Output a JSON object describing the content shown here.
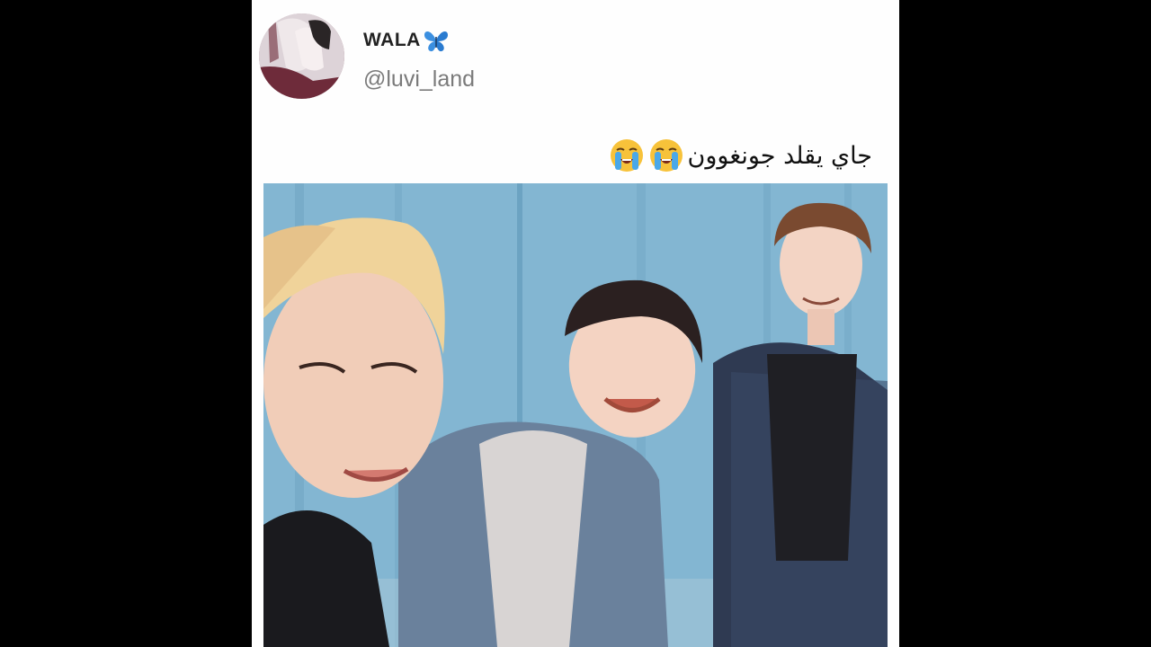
{
  "tweet": {
    "display_name": "WALA",
    "handle": "@luvi_land",
    "text": "جاي يقلد جونغوون",
    "name_icon": "butterfly-icon",
    "text_emoji": [
      "loudly-crying-face-icon",
      "loudly-crying-face-icon"
    ]
  },
  "colors": {
    "background": "#000000",
    "card": "#fefefe",
    "butterfly": "#3b8fe0",
    "handle": "#7a7a7a",
    "curtain": "#7fb3cf"
  }
}
